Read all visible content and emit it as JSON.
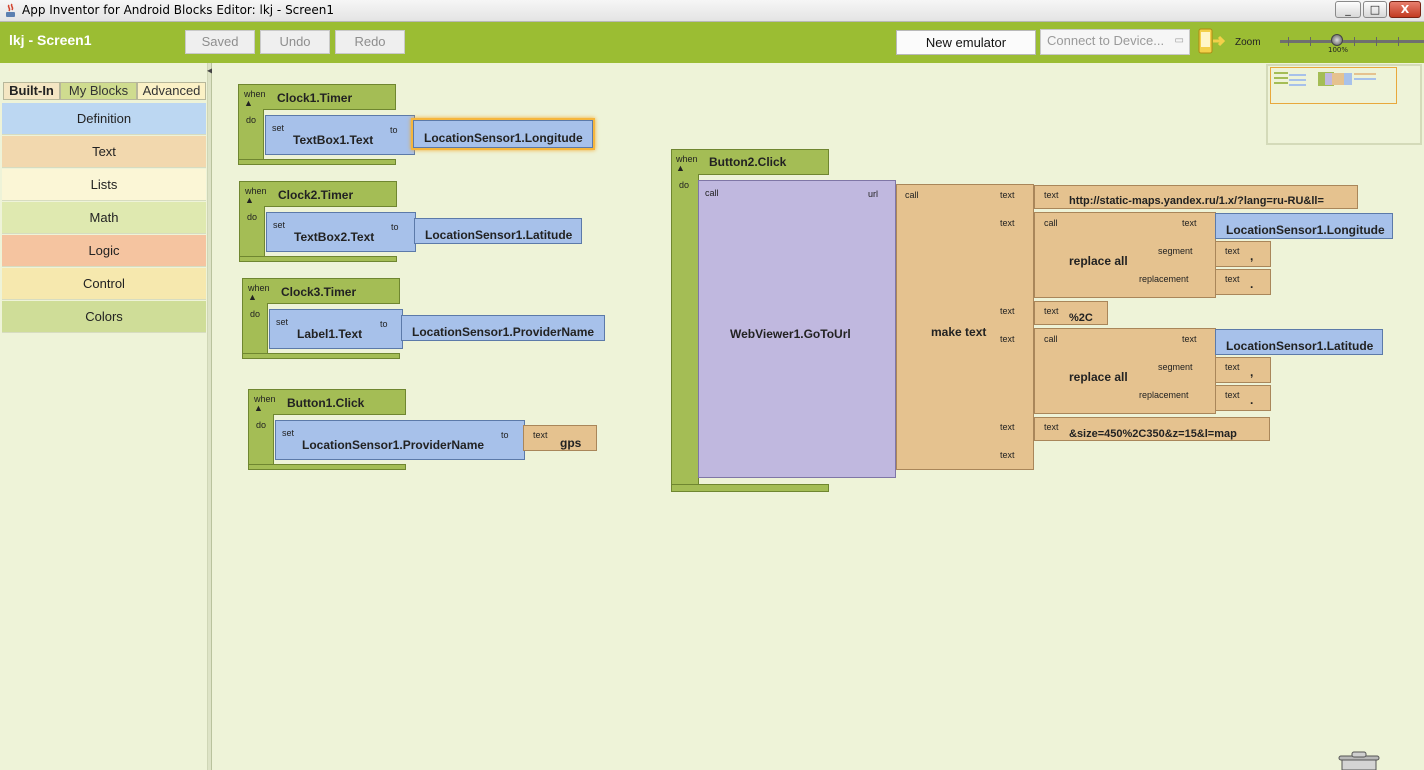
{
  "window": {
    "title": "App Inventor for Android Blocks Editor: lkj - Screen1",
    "controls": [
      "_",
      "□",
      "X"
    ]
  },
  "toolbar": {
    "project_title": "lkj - Screen1",
    "saved_label": "Saved",
    "undo_label": "Undo",
    "redo_label": "Redo",
    "new_emulator_label": "New emulator",
    "connect_placeholder": "Connect to Device...",
    "zoom_label": "Zoom",
    "zoom_value": "100%"
  },
  "palette": {
    "tabs": [
      "Built-In",
      "My Blocks",
      "Advanced"
    ],
    "active_tab": "Built-In",
    "drawers": [
      {
        "label": "Definition",
        "color": "#bcd7f2"
      },
      {
        "label": "Text",
        "color": "#f2d8ae"
      },
      {
        "label": "Lists",
        "color": "#fbf6d6"
      },
      {
        "label": "Math",
        "color": "#dfe9b0"
      },
      {
        "label": "Logic",
        "color": "#f5c4a0"
      },
      {
        "label": "Control",
        "color": "#f6e8ae"
      },
      {
        "label": "Colors",
        "color": "#cfdd98"
      }
    ]
  },
  "blocks": {
    "kw_when": "when",
    "kw_do": "do",
    "kw_set": "set",
    "kw_to": "to",
    "kw_call": "call",
    "kw_text": "text",
    "kw_url": "url",
    "kw_segment": "segment",
    "kw_replacement": "replacement",
    "clock1": {
      "event": "Clock1.Timer",
      "setter": "TextBox1.Text",
      "value": "LocationSensor1.Longitude"
    },
    "clock2": {
      "event": "Clock2.Timer",
      "setter": "TextBox2.Text",
      "value": "LocationSensor1.Latitude"
    },
    "clock3": {
      "event": "Clock3.Timer",
      "setter": "Label1.Text",
      "value": "LocationSensor1.ProviderName"
    },
    "button1": {
      "event": "Button1.Click",
      "setter": "LocationSensor1.ProviderName",
      "value": "gps"
    },
    "button2": {
      "event": "Button2.Click",
      "method": "WebViewer1.GoToUrl",
      "make_text": "make text",
      "url_text": "http://static-maps.yandex.ru/1.x/?lang=ru-RU&ll=",
      "replace_all": "replace all",
      "longitude": "LocationSensor1.Longitude",
      "latitude": "LocationSensor1.Latitude",
      "comma": ",",
      "dot": ".",
      "sep_text": "%2C",
      "size_text": "&size=450%2C350&z=15&l=map"
    }
  },
  "colors": {
    "toolbar": "#9bbd33",
    "workspace": "#eef3d8",
    "event_block": "#a4bd55",
    "component_block": "#a7c1ea",
    "text_block": "#e5c28f",
    "method_block": "#c0b8df",
    "selection": "#f5b63d"
  }
}
